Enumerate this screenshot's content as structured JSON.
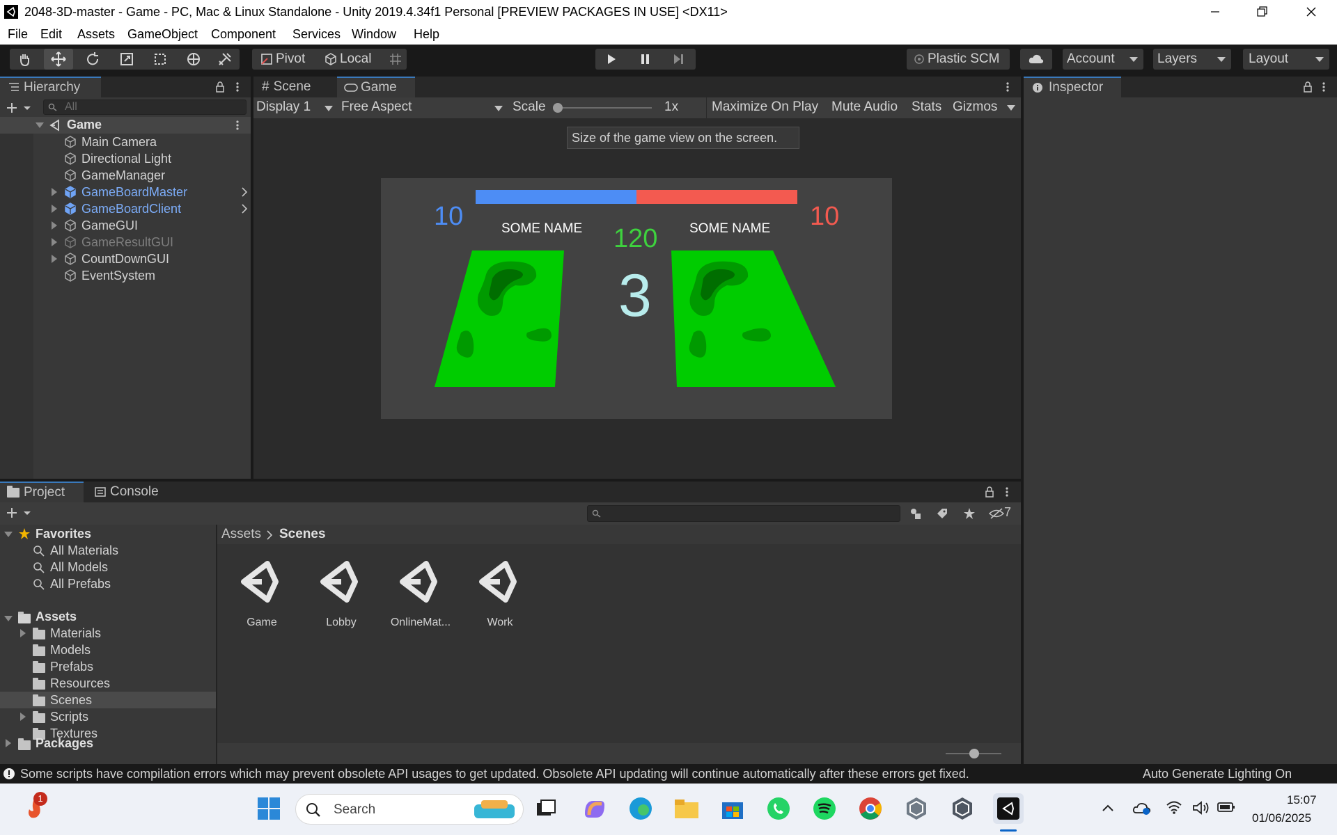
{
  "window": {
    "title": "2048-3D-master - Game - PC, Mac & Linux Standalone - Unity 2019.4.34f1 Personal [PREVIEW PACKAGES IN USE] <DX11>"
  },
  "menu": [
    "File",
    "Edit",
    "Assets",
    "GameObject",
    "Component",
    "Services",
    "Window",
    "Help"
  ],
  "toolbar": {
    "pivot": "Pivot",
    "local": "Local",
    "plastic": "Plastic SCM",
    "account": "Account",
    "layers": "Layers",
    "layout": "Layout"
  },
  "hierarchy": {
    "tab": "Hierarchy",
    "search_placeholder": "All",
    "scene": "Game",
    "items": [
      {
        "label": "Main Camera",
        "style": "normal"
      },
      {
        "label": "Directional Light",
        "style": "normal"
      },
      {
        "label": "GameManager",
        "style": "normal"
      },
      {
        "label": "GameBoardMaster",
        "style": "prefab"
      },
      {
        "label": "GameBoardClient",
        "style": "prefab"
      },
      {
        "label": "GameGUI",
        "style": "normal"
      },
      {
        "label": "GameResultGUI",
        "style": "disabled"
      },
      {
        "label": "CountDownGUI",
        "style": "normal"
      },
      {
        "label": "EventSystem",
        "style": "normal"
      }
    ]
  },
  "game_view": {
    "tabs": [
      "Scene",
      "Game"
    ],
    "display": "Display 1",
    "aspect": "Free Aspect",
    "scale_label": "Scale",
    "scale_value": "1x",
    "maximize": "Maximize On Play",
    "mute": "Mute Audio",
    "stats": "Stats",
    "gizmos": "Gizmos",
    "tooltip": "Size of the game view on the screen.",
    "score_left": "10",
    "score_right": "10",
    "name_left": "SOME NAME",
    "name_right": "SOME NAME",
    "timer": "120",
    "countdown": "3",
    "progress_blue_fraction": 0.5,
    "colors": {
      "blue": "#4d8df5",
      "red": "#f35a50",
      "green": "#00cc00",
      "timer": "#3ed23e"
    }
  },
  "inspector": {
    "tab": "Inspector"
  },
  "project": {
    "tabs": [
      "Project",
      "Console"
    ],
    "hidden_count": "7",
    "favorites": {
      "label": "Favorites",
      "items": [
        "All Materials",
        "All Models",
        "All Prefabs"
      ]
    },
    "assets": {
      "label": "Assets",
      "items": [
        "Materials",
        "Models",
        "Prefabs",
        "Resources",
        "Scenes",
        "Scripts",
        "Textures"
      ]
    },
    "packages": "Packages",
    "breadcrumb": [
      "Assets",
      "Scenes"
    ],
    "files": [
      "Game",
      "Lobby",
      "OnlineMat...",
      "Work"
    ]
  },
  "status": {
    "message": "Some scripts have compilation errors which may prevent obsolete API usages to get updated. Obsolete API updating will continue automatically after these errors get fixed.",
    "right": "Auto Generate Lighting On"
  },
  "taskbar": {
    "search": "Search",
    "time": "15:07",
    "date": "01/06/2025",
    "notification_badge": "1"
  }
}
